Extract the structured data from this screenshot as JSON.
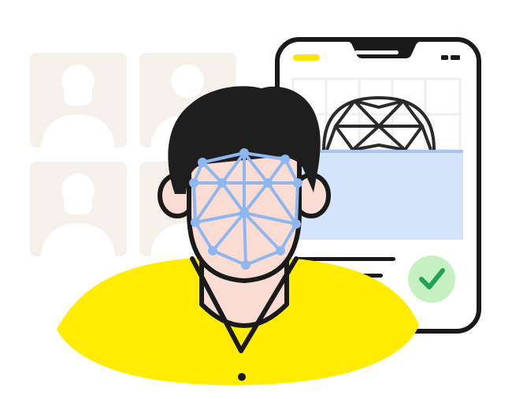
{
  "illustration": {
    "kind": "face-recognition-verification",
    "icons": {
      "profile_placeholder": "user-silhouette-icon",
      "face_mesh": "face-mesh-icon",
      "wireframe_sphere": "globe-wireframe-icon",
      "verified": "checkmark-icon"
    },
    "colors": {
      "outline": "#1a1a1a",
      "profile_tile_bg": "#f5f1ea",
      "profile_silhouette": "#ffffff",
      "phone_screen": "#ffffff",
      "phone_accent": "#ffe400",
      "hair": "#1e1e1e",
      "skin": "#fbdcd2",
      "mesh": "#8fb7ef",
      "shirt": "#ffec00",
      "info_panel": "#d4e4fb",
      "check_bg": "#c6f0c1",
      "check_mark": "#21a452",
      "grid_lines": "#efefef"
    }
  }
}
